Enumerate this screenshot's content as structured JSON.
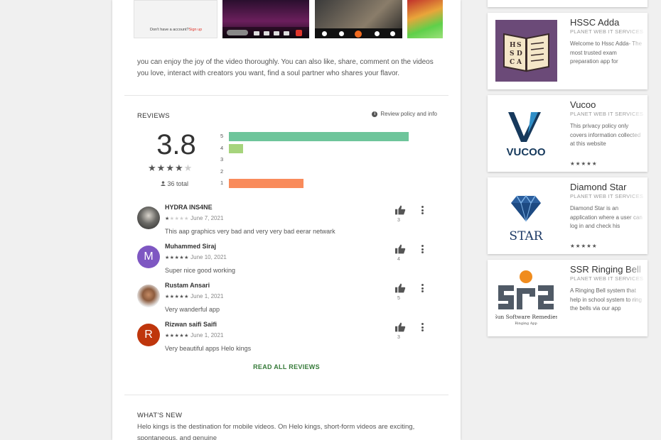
{
  "screenshots": {
    "signup_text": "Don't have a account?",
    "signup_link": "Sign up"
  },
  "description": "you can enjoy the joy of the video thoroughly. You can also like, share, comment on the videos you love, interact with creators you want, find a soul partner who shares your flavor.",
  "reviews": {
    "title": "REVIEWS",
    "policy_label": "Review policy and info",
    "score": "3.8",
    "stars": 4,
    "total": "36 total",
    "histogram": [
      {
        "stars": "5",
        "fraction": 0.99,
        "color": "#6ec59b"
      },
      {
        "stars": "4",
        "fraction": 0.08,
        "color": "#a6d47c"
      },
      {
        "stars": "3",
        "fraction": 0,
        "color": "#e6e07a"
      },
      {
        "stars": "2",
        "fraction": 0,
        "color": "#f5b05a"
      },
      {
        "stars": "1",
        "fraction": 0.41,
        "color": "#f98b5b"
      }
    ],
    "items": [
      {
        "name": "HYDRA INS4NE",
        "stars": 1,
        "date": "June 7, 2021",
        "text": "This aap graphics very bad and very very bad eerar netwark",
        "likes": "3",
        "avatar": "photo",
        "initial": ""
      },
      {
        "name": "Muhammed Siraj",
        "stars": 5,
        "date": "June 10, 2021",
        "text": "Super nice good working",
        "likes": "4",
        "avatar": "#7e57c2",
        "initial": "M"
      },
      {
        "name": "Rustam Ansari",
        "stars": 5,
        "date": "June 1, 2021",
        "text": "Very wanderful app",
        "likes": "5",
        "avatar": "photo2",
        "initial": ""
      },
      {
        "name": "Rizwan saifi Saifi",
        "stars": 5,
        "date": "June 1, 2021",
        "text": "Very beautiful apps Helo kings",
        "likes": "3",
        "avatar": "#bf360c",
        "initial": "R"
      }
    ],
    "read_all": "READ ALL REVIEWS"
  },
  "whats_new": {
    "title": "WHAT'S NEW",
    "text": "Helo kings is the destination for mobile videos. On Helo kings, short-form videos are exciting, spontaneous, and genuine"
  },
  "similar": [
    {
      "title": "HSSC Adda",
      "developer": "PLANET WEB IT SERVICES",
      "desc": "Welcome to Hssc Adda- The most trusted exam preparation app for",
      "stars": ""
    },
    {
      "title": "Vucoo",
      "developer": "PLANET WEB IT SERVICES",
      "desc": "This privacy policy only covers information collected at this website",
      "stars": "★★★★★",
      "logo_text": "VUCOO"
    },
    {
      "title": "Diamond Star",
      "developer": "PLANET WEB IT SERVICES",
      "desc": "Diamond Star is an application where a user can log in and check his",
      "stars": "★★★★★",
      "logo_text": "STAR"
    },
    {
      "title": "SSR Ringing Bell",
      "developer": "PLANET WEB IT SERVICES",
      "desc": "A Ringing Bell system that help in school system to ring the bells via our app",
      "stars": "",
      "logo_text": "Sun Software Remedies",
      "logo_sub": "Ringing App"
    }
  ],
  "colors": {
    "accent_green": "#357a38"
  }
}
